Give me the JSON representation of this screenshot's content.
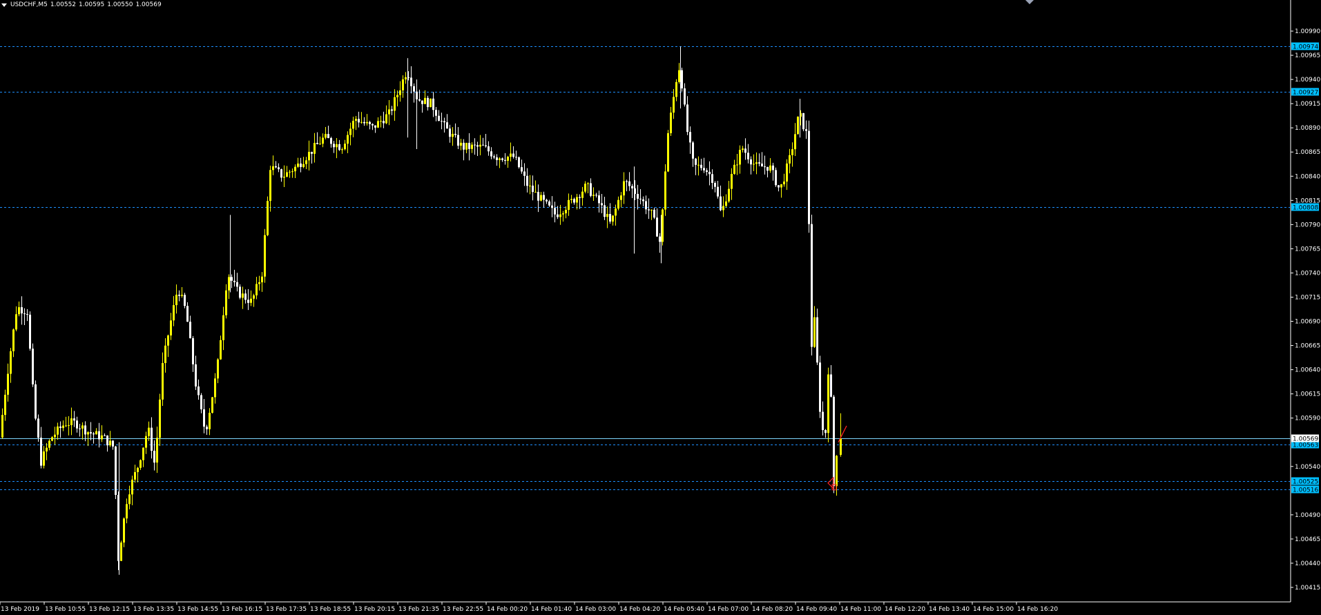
{
  "header": {
    "symbol": "USDCHF,M5",
    "open": "1.00552",
    "high": "1.00595",
    "low": "1.00550",
    "close": "1.00569"
  },
  "chart_data": {
    "type": "candlestick",
    "title": "USDCHF,M5",
    "ylim": [
      1.00405,
      1.01015
    ],
    "y_ticks": [
      "1.00990",
      "1.00965",
      "1.00940",
      "1.00915",
      "1.00890",
      "1.00865",
      "1.00840",
      "1.00815",
      "1.00790",
      "1.00765",
      "1.00740",
      "1.00715",
      "1.00690",
      "1.00665",
      "1.00640",
      "1.00615",
      "1.00590",
      "1.00540",
      "1.00490",
      "1.00465",
      "1.00440",
      "1.00415"
    ],
    "x_labels": [
      "13 Feb 2019",
      "13 Feb 10:55",
      "13 Feb 12:15",
      "13 Feb 13:35",
      "13 Feb 14:55",
      "13 Feb 16:15",
      "13 Feb 17:35",
      "13 Feb 18:55",
      "13 Feb 20:15",
      "13 Feb 21:35",
      "13 Feb 22:55",
      "14 Feb 00:20",
      "14 Feb 01:40",
      "14 Feb 03:00",
      "14 Feb 04:20",
      "14 Feb 05:40",
      "14 Feb 07:00",
      "14 Feb 08:20",
      "14 Feb 09:40",
      "14 Feb 11:00",
      "14 Feb 12:20",
      "14 Feb 13:40",
      "14 Feb 15:00",
      "14 Feb 16:20"
    ],
    "hlines": [
      {
        "price": 1.00974,
        "label": "1.00974"
      },
      {
        "price": 1.00927,
        "label": "1.00927"
      },
      {
        "price": 1.00808,
        "label": "1.00808"
      },
      {
        "price": 1.00563,
        "label": "1.00563"
      },
      {
        "price": 1.00525,
        "label": "1.00525"
      },
      {
        "price": 1.00516,
        "label": "1.00516"
      }
    ],
    "current_price": {
      "price": 1.00569,
      "label": "1.00569"
    },
    "colors": {
      "background": "#000000",
      "bull": "#ffff00",
      "bear": "#ffffff",
      "hline": "#1e90ff",
      "price_tag": "#00bfff",
      "arrow": "#ff2020",
      "axis": "#ffffff"
    },
    "price_path": [
      {
        "x": 0,
        "p": 1.0057
      },
      {
        "x": 12,
        "p": 1.0064
      },
      {
        "x": 25,
        "p": 1.00705
      },
      {
        "x": 40,
        "p": 1.007
      },
      {
        "x": 50,
        "p": 1.006
      },
      {
        "x": 60,
        "p": 1.00545
      },
      {
        "x": 75,
        "p": 1.0057
      },
      {
        "x": 95,
        "p": 1.00585
      },
      {
        "x": 110,
        "p": 1.00585
      },
      {
        "x": 130,
        "p": 1.00575
      },
      {
        "x": 150,
        "p": 1.0057
      },
      {
        "x": 165,
        "p": 1.0056
      },
      {
        "x": 172,
        "p": 1.00445
      },
      {
        "x": 185,
        "p": 1.0051
      },
      {
        "x": 200,
        "p": 1.0054
      },
      {
        "x": 215,
        "p": 1.0058
      },
      {
        "x": 225,
        "p": 1.0054
      },
      {
        "x": 235,
        "p": 1.0064
      },
      {
        "x": 245,
        "p": 1.0068
      },
      {
        "x": 258,
        "p": 1.00725
      },
      {
        "x": 270,
        "p": 1.007
      },
      {
        "x": 285,
        "p": 1.0062
      },
      {
        "x": 298,
        "p": 1.00575
      },
      {
        "x": 315,
        "p": 1.0064
      },
      {
        "x": 330,
        "p": 1.0074
      },
      {
        "x": 345,
        "p": 1.0072
      },
      {
        "x": 365,
        "p": 1.0071
      },
      {
        "x": 380,
        "p": 1.0074
      },
      {
        "x": 392,
        "p": 1.0085
      },
      {
        "x": 410,
        "p": 1.0084
      },
      {
        "x": 430,
        "p": 1.0085
      },
      {
        "x": 450,
        "p": 1.00865
      },
      {
        "x": 470,
        "p": 1.0088
      },
      {
        "x": 495,
        "p": 1.0087
      },
      {
        "x": 515,
        "p": 1.009
      },
      {
        "x": 540,
        "p": 1.0089
      },
      {
        "x": 565,
        "p": 1.00905
      },
      {
        "x": 590,
        "p": 1.0095
      },
      {
        "x": 605,
        "p": 1.0092
      },
      {
        "x": 625,
        "p": 1.00915
      },
      {
        "x": 645,
        "p": 1.0089
      },
      {
        "x": 670,
        "p": 1.0087
      },
      {
        "x": 700,
        "p": 1.0087
      },
      {
        "x": 720,
        "p": 1.0086
      },
      {
        "x": 745,
        "p": 1.0086
      },
      {
        "x": 765,
        "p": 1.0083
      },
      {
        "x": 785,
        "p": 1.00815
      },
      {
        "x": 805,
        "p": 1.008
      },
      {
        "x": 830,
        "p": 1.00815
      },
      {
        "x": 850,
        "p": 1.0083
      },
      {
        "x": 870,
        "p": 1.0081
      },
      {
        "x": 885,
        "p": 1.0079
      },
      {
        "x": 905,
        "p": 1.00835
      },
      {
        "x": 925,
        "p": 1.0082
      },
      {
        "x": 945,
        "p": 1.008
      },
      {
        "x": 957,
        "p": 1.0077
      },
      {
        "x": 967,
        "p": 1.0088
      },
      {
        "x": 980,
        "p": 1.0094
      },
      {
        "x": 985,
        "p": 1.00955
      },
      {
        "x": 995,
        "p": 1.0089
      },
      {
        "x": 1005,
        "p": 1.0085
      },
      {
        "x": 1020,
        "p": 1.0085
      },
      {
        "x": 1035,
        "p": 1.00835
      },
      {
        "x": 1045,
        "p": 1.008
      },
      {
        "x": 1060,
        "p": 1.0084
      },
      {
        "x": 1075,
        "p": 1.0087
      },
      {
        "x": 1095,
        "p": 1.0085
      },
      {
        "x": 1115,
        "p": 1.0085
      },
      {
        "x": 1130,
        "p": 1.00825
      },
      {
        "x": 1145,
        "p": 1.0086
      },
      {
        "x": 1158,
        "p": 1.00905
      },
      {
        "x": 1170,
        "p": 1.0088
      },
      {
        "x": 1175,
        "p": 1.0066
      },
      {
        "x": 1180,
        "p": 1.0069
      },
      {
        "x": 1188,
        "p": 1.006
      },
      {
        "x": 1195,
        "p": 1.0056
      },
      {
        "x": 1200,
        "p": 1.0064
      },
      {
        "x": 1205,
        "p": 1.006
      },
      {
        "x": 1208,
        "p": 1.0052
      },
      {
        "x": 1212,
        "p": 1.00555
      },
      {
        "x": 1216,
        "p": 1.00569
      }
    ],
    "spikes": [
      {
        "x": 172,
        "high": 1.00565,
        "low": 1.00428
      },
      {
        "x": 333,
        "high": 1.008,
        "low": 1.0072
      },
      {
        "x": 590,
        "high": 1.00962,
        "low": 1.0088
      },
      {
        "x": 603,
        "high": 1.0094,
        "low": 1.00868
      },
      {
        "x": 918,
        "high": 1.0085,
        "low": 1.0076
      },
      {
        "x": 957,
        "high": 1.008,
        "low": 1.0075
      },
      {
        "x": 985,
        "high": 1.00974,
        "low": 1.0091
      },
      {
        "x": 1158,
        "high": 1.0092,
        "low": 1.0088
      }
    ],
    "last_bar": {
      "x": 1216,
      "open": 1.00552,
      "high": 1.00595,
      "low": 1.0055,
      "close": 1.00569
    }
  }
}
